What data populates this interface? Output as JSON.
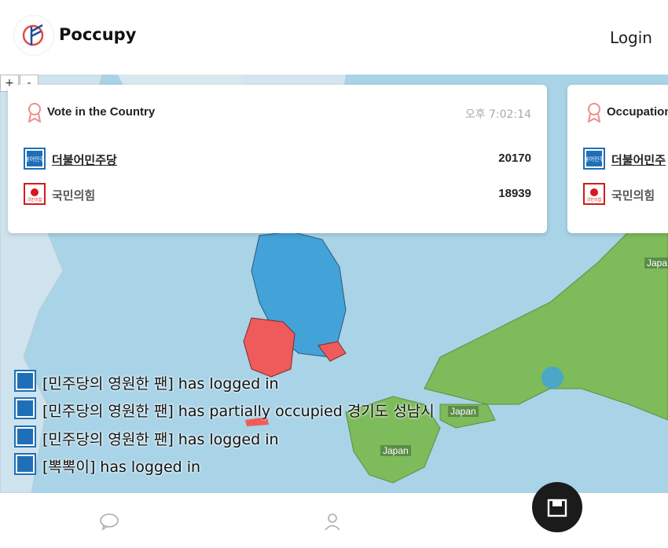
{
  "app": {
    "name": "Poccupy",
    "login_label": "Login"
  },
  "cards": [
    {
      "title": "Vote in the Country",
      "time": "오후 7:02:14",
      "rows": [
        {
          "party": "더불어민주당",
          "votes": "20170"
        },
        {
          "party": "국민의힘",
          "votes": "18939"
        }
      ]
    },
    {
      "title": "Occupation",
      "rows": [
        {
          "party": "더불어민주"
        },
        {
          "party": "국민의힘"
        }
      ]
    }
  ],
  "logs": [
    {
      "text": "[민주당의 영원한 팬] has logged in"
    },
    {
      "text": "[민주당의 영원한 팬] has partially occupied 경기도 성남시"
    },
    {
      "text": "[민주당의 영원한 팬] has logged in"
    },
    {
      "text": "[뽁뽁이] has logged in"
    }
  ],
  "map": {
    "labels": [
      "Japan",
      "Japan",
      "Japa"
    ],
    "colors": {
      "sea": "#a9d3e6",
      "land": "#7dbb5b",
      "democratic": "#43a2d8",
      "ppp": "#ef5b5b"
    },
    "zoom": [
      "+",
      "-"
    ]
  },
  "party_logo_text": {
    "democratic": "더불어민주당",
    "ppp": "국민의힘"
  },
  "nav": {
    "icons": [
      "chat-icon",
      "user-icon",
      "box-icon"
    ]
  }
}
